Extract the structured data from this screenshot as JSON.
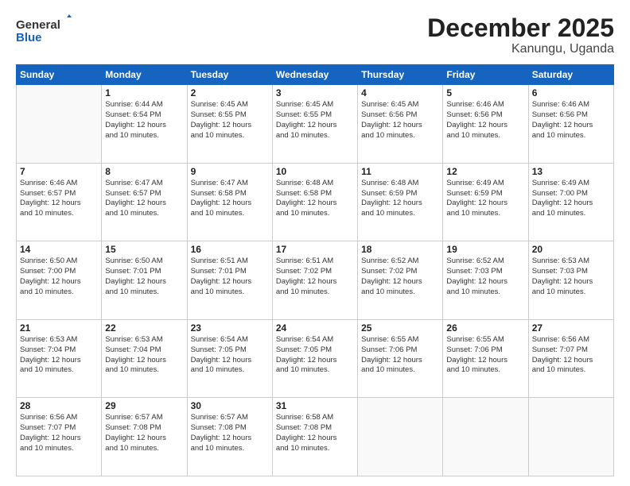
{
  "header": {
    "logo_line1": "General",
    "logo_line2": "Blue",
    "title": "December 2025",
    "subtitle": "Kanungu, Uganda"
  },
  "calendar": {
    "days_of_week": [
      "Sunday",
      "Monday",
      "Tuesday",
      "Wednesday",
      "Thursday",
      "Friday",
      "Saturday"
    ],
    "weeks": [
      [
        {
          "day": "",
          "info": ""
        },
        {
          "day": "1",
          "info": "Sunrise: 6:44 AM\nSunset: 6:54 PM\nDaylight: 12 hours\nand 10 minutes."
        },
        {
          "day": "2",
          "info": "Sunrise: 6:45 AM\nSunset: 6:55 PM\nDaylight: 12 hours\nand 10 minutes."
        },
        {
          "day": "3",
          "info": "Sunrise: 6:45 AM\nSunset: 6:55 PM\nDaylight: 12 hours\nand 10 minutes."
        },
        {
          "day": "4",
          "info": "Sunrise: 6:45 AM\nSunset: 6:56 PM\nDaylight: 12 hours\nand 10 minutes."
        },
        {
          "day": "5",
          "info": "Sunrise: 6:46 AM\nSunset: 6:56 PM\nDaylight: 12 hours\nand 10 minutes."
        },
        {
          "day": "6",
          "info": "Sunrise: 6:46 AM\nSunset: 6:56 PM\nDaylight: 12 hours\nand 10 minutes."
        }
      ],
      [
        {
          "day": "7",
          "info": "Sunrise: 6:46 AM\nSunset: 6:57 PM\nDaylight: 12 hours\nand 10 minutes."
        },
        {
          "day": "8",
          "info": "Sunrise: 6:47 AM\nSunset: 6:57 PM\nDaylight: 12 hours\nand 10 minutes."
        },
        {
          "day": "9",
          "info": "Sunrise: 6:47 AM\nSunset: 6:58 PM\nDaylight: 12 hours\nand 10 minutes."
        },
        {
          "day": "10",
          "info": "Sunrise: 6:48 AM\nSunset: 6:58 PM\nDaylight: 12 hours\nand 10 minutes."
        },
        {
          "day": "11",
          "info": "Sunrise: 6:48 AM\nSunset: 6:59 PM\nDaylight: 12 hours\nand 10 minutes."
        },
        {
          "day": "12",
          "info": "Sunrise: 6:49 AM\nSunset: 6:59 PM\nDaylight: 12 hours\nand 10 minutes."
        },
        {
          "day": "13",
          "info": "Sunrise: 6:49 AM\nSunset: 7:00 PM\nDaylight: 12 hours\nand 10 minutes."
        }
      ],
      [
        {
          "day": "14",
          "info": "Sunrise: 6:50 AM\nSunset: 7:00 PM\nDaylight: 12 hours\nand 10 minutes."
        },
        {
          "day": "15",
          "info": "Sunrise: 6:50 AM\nSunset: 7:01 PM\nDaylight: 12 hours\nand 10 minutes."
        },
        {
          "day": "16",
          "info": "Sunrise: 6:51 AM\nSunset: 7:01 PM\nDaylight: 12 hours\nand 10 minutes."
        },
        {
          "day": "17",
          "info": "Sunrise: 6:51 AM\nSunset: 7:02 PM\nDaylight: 12 hours\nand 10 minutes."
        },
        {
          "day": "18",
          "info": "Sunrise: 6:52 AM\nSunset: 7:02 PM\nDaylight: 12 hours\nand 10 minutes."
        },
        {
          "day": "19",
          "info": "Sunrise: 6:52 AM\nSunset: 7:03 PM\nDaylight: 12 hours\nand 10 minutes."
        },
        {
          "day": "20",
          "info": "Sunrise: 6:53 AM\nSunset: 7:03 PM\nDaylight: 12 hours\nand 10 minutes."
        }
      ],
      [
        {
          "day": "21",
          "info": "Sunrise: 6:53 AM\nSunset: 7:04 PM\nDaylight: 12 hours\nand 10 minutes."
        },
        {
          "day": "22",
          "info": "Sunrise: 6:53 AM\nSunset: 7:04 PM\nDaylight: 12 hours\nand 10 minutes."
        },
        {
          "day": "23",
          "info": "Sunrise: 6:54 AM\nSunset: 7:05 PM\nDaylight: 12 hours\nand 10 minutes."
        },
        {
          "day": "24",
          "info": "Sunrise: 6:54 AM\nSunset: 7:05 PM\nDaylight: 12 hours\nand 10 minutes."
        },
        {
          "day": "25",
          "info": "Sunrise: 6:55 AM\nSunset: 7:06 PM\nDaylight: 12 hours\nand 10 minutes."
        },
        {
          "day": "26",
          "info": "Sunrise: 6:55 AM\nSunset: 7:06 PM\nDaylight: 12 hours\nand 10 minutes."
        },
        {
          "day": "27",
          "info": "Sunrise: 6:56 AM\nSunset: 7:07 PM\nDaylight: 12 hours\nand 10 minutes."
        }
      ],
      [
        {
          "day": "28",
          "info": "Sunrise: 6:56 AM\nSunset: 7:07 PM\nDaylight: 12 hours\nand 10 minutes."
        },
        {
          "day": "29",
          "info": "Sunrise: 6:57 AM\nSunset: 7:08 PM\nDaylight: 12 hours\nand 10 minutes."
        },
        {
          "day": "30",
          "info": "Sunrise: 6:57 AM\nSunset: 7:08 PM\nDaylight: 12 hours\nand 10 minutes."
        },
        {
          "day": "31",
          "info": "Sunrise: 6:58 AM\nSunset: 7:08 PM\nDaylight: 12 hours\nand 10 minutes."
        },
        {
          "day": "",
          "info": ""
        },
        {
          "day": "",
          "info": ""
        },
        {
          "day": "",
          "info": ""
        }
      ]
    ]
  }
}
